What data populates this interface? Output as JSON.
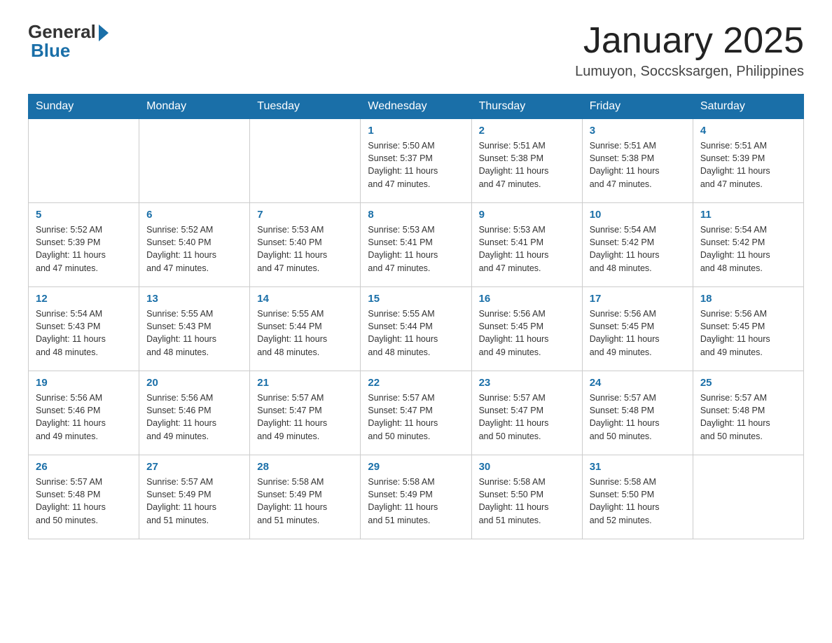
{
  "header": {
    "logo_general": "General",
    "logo_blue": "Blue",
    "month_title": "January 2025",
    "location": "Lumuyon, Soccsksargen, Philippines"
  },
  "weekdays": [
    "Sunday",
    "Monday",
    "Tuesday",
    "Wednesday",
    "Thursday",
    "Friday",
    "Saturday"
  ],
  "weeks": [
    [
      {
        "day": "",
        "info": ""
      },
      {
        "day": "",
        "info": ""
      },
      {
        "day": "",
        "info": ""
      },
      {
        "day": "1",
        "info": "Sunrise: 5:50 AM\nSunset: 5:37 PM\nDaylight: 11 hours\nand 47 minutes."
      },
      {
        "day": "2",
        "info": "Sunrise: 5:51 AM\nSunset: 5:38 PM\nDaylight: 11 hours\nand 47 minutes."
      },
      {
        "day": "3",
        "info": "Sunrise: 5:51 AM\nSunset: 5:38 PM\nDaylight: 11 hours\nand 47 minutes."
      },
      {
        "day": "4",
        "info": "Sunrise: 5:51 AM\nSunset: 5:39 PM\nDaylight: 11 hours\nand 47 minutes."
      }
    ],
    [
      {
        "day": "5",
        "info": "Sunrise: 5:52 AM\nSunset: 5:39 PM\nDaylight: 11 hours\nand 47 minutes."
      },
      {
        "day": "6",
        "info": "Sunrise: 5:52 AM\nSunset: 5:40 PM\nDaylight: 11 hours\nand 47 minutes."
      },
      {
        "day": "7",
        "info": "Sunrise: 5:53 AM\nSunset: 5:40 PM\nDaylight: 11 hours\nand 47 minutes."
      },
      {
        "day": "8",
        "info": "Sunrise: 5:53 AM\nSunset: 5:41 PM\nDaylight: 11 hours\nand 47 minutes."
      },
      {
        "day": "9",
        "info": "Sunrise: 5:53 AM\nSunset: 5:41 PM\nDaylight: 11 hours\nand 47 minutes."
      },
      {
        "day": "10",
        "info": "Sunrise: 5:54 AM\nSunset: 5:42 PM\nDaylight: 11 hours\nand 48 minutes."
      },
      {
        "day": "11",
        "info": "Sunrise: 5:54 AM\nSunset: 5:42 PM\nDaylight: 11 hours\nand 48 minutes."
      }
    ],
    [
      {
        "day": "12",
        "info": "Sunrise: 5:54 AM\nSunset: 5:43 PM\nDaylight: 11 hours\nand 48 minutes."
      },
      {
        "day": "13",
        "info": "Sunrise: 5:55 AM\nSunset: 5:43 PM\nDaylight: 11 hours\nand 48 minutes."
      },
      {
        "day": "14",
        "info": "Sunrise: 5:55 AM\nSunset: 5:44 PM\nDaylight: 11 hours\nand 48 minutes."
      },
      {
        "day": "15",
        "info": "Sunrise: 5:55 AM\nSunset: 5:44 PM\nDaylight: 11 hours\nand 48 minutes."
      },
      {
        "day": "16",
        "info": "Sunrise: 5:56 AM\nSunset: 5:45 PM\nDaylight: 11 hours\nand 49 minutes."
      },
      {
        "day": "17",
        "info": "Sunrise: 5:56 AM\nSunset: 5:45 PM\nDaylight: 11 hours\nand 49 minutes."
      },
      {
        "day": "18",
        "info": "Sunrise: 5:56 AM\nSunset: 5:45 PM\nDaylight: 11 hours\nand 49 minutes."
      }
    ],
    [
      {
        "day": "19",
        "info": "Sunrise: 5:56 AM\nSunset: 5:46 PM\nDaylight: 11 hours\nand 49 minutes."
      },
      {
        "day": "20",
        "info": "Sunrise: 5:56 AM\nSunset: 5:46 PM\nDaylight: 11 hours\nand 49 minutes."
      },
      {
        "day": "21",
        "info": "Sunrise: 5:57 AM\nSunset: 5:47 PM\nDaylight: 11 hours\nand 49 minutes."
      },
      {
        "day": "22",
        "info": "Sunrise: 5:57 AM\nSunset: 5:47 PM\nDaylight: 11 hours\nand 50 minutes."
      },
      {
        "day": "23",
        "info": "Sunrise: 5:57 AM\nSunset: 5:47 PM\nDaylight: 11 hours\nand 50 minutes."
      },
      {
        "day": "24",
        "info": "Sunrise: 5:57 AM\nSunset: 5:48 PM\nDaylight: 11 hours\nand 50 minutes."
      },
      {
        "day": "25",
        "info": "Sunrise: 5:57 AM\nSunset: 5:48 PM\nDaylight: 11 hours\nand 50 minutes."
      }
    ],
    [
      {
        "day": "26",
        "info": "Sunrise: 5:57 AM\nSunset: 5:48 PM\nDaylight: 11 hours\nand 50 minutes."
      },
      {
        "day": "27",
        "info": "Sunrise: 5:57 AM\nSunset: 5:49 PM\nDaylight: 11 hours\nand 51 minutes."
      },
      {
        "day": "28",
        "info": "Sunrise: 5:58 AM\nSunset: 5:49 PM\nDaylight: 11 hours\nand 51 minutes."
      },
      {
        "day": "29",
        "info": "Sunrise: 5:58 AM\nSunset: 5:49 PM\nDaylight: 11 hours\nand 51 minutes."
      },
      {
        "day": "30",
        "info": "Sunrise: 5:58 AM\nSunset: 5:50 PM\nDaylight: 11 hours\nand 51 minutes."
      },
      {
        "day": "31",
        "info": "Sunrise: 5:58 AM\nSunset: 5:50 PM\nDaylight: 11 hours\nand 52 minutes."
      },
      {
        "day": "",
        "info": ""
      }
    ]
  ]
}
